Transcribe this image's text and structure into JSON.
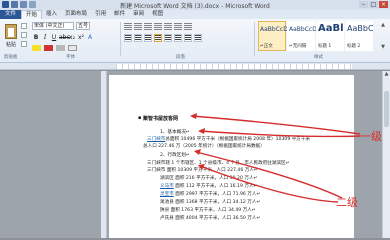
{
  "window": {
    "title": "新建 Microsoft Word 文档 (3).docx - Microsoft Word"
  },
  "tabs": [
    "文件",
    "开始",
    "插入",
    "页面布局",
    "引用",
    "邮件",
    "审阅",
    "视图"
  ],
  "ribbon": {
    "paste_label": "粘贴",
    "font_name": "宋体 (中文正)",
    "font_size": "五号",
    "styles": [
      {
        "sample": "AaBbCcDc",
        "name": "↵正文"
      },
      {
        "sample": "AaBbCcDc",
        "name": "↵无间隔"
      },
      {
        "sample": "AaBl",
        "name": "标题 1"
      },
      {
        "sample": "AaBbC",
        "name": "标题 2"
      }
    ],
    "group_labels": [
      "剪贴板",
      "字体",
      "段落",
      "样式"
    ]
  },
  "document": {
    "heading": "聚智书屋放客网",
    "lines": [
      {
        "text": "1、基本概况↵",
        "link": ""
      },
      {
        "text": "",
        "link": "三门峡市",
        "rest": "总面积 10496 平方千米（根据国家统计局 2008 年）10309 平方千米"
      },
      {
        "text": "总人口 227.46 万（2005 年统计）（根据国家统计局数据）",
        "link": ""
      },
      {
        "text": "2、行政区划↵",
        "link": ""
      },
      {
        "text": "三门峡市辖 1 个市辖区、1 个县级市、4 个县，市人民政府驻湖滨区↵",
        "link": ""
      },
      {
        "text": "三门峡市  面积 10309 平方千米，人口 227.46 万人↵",
        "link": ""
      },
      {
        "text": "湖滨区  面积 216 平方千米，人口 30.20 万人↵",
        "link": ""
      },
      {
        "text": "",
        "link": "义马市",
        "rest": "  面积 112 平方千米，人口 16.19 万人↵"
      },
      {
        "text": "",
        "link": "灵宝市",
        "rest": "  面积 2997 平方千米，人口 71.96 万人↵"
      },
      {
        "text": "渑池县  面积 1368 平方千米，人口 34.12 万人↵",
        "link": ""
      },
      {
        "text": "陕县  面积 1763 平方千米，人口 34.49 万人↵",
        "link": ""
      },
      {
        "text": "卢氏县  面积 4004 平方千米，人口 36.50 万人↵",
        "link": ""
      }
    ]
  },
  "annotations": {
    "level1": "一级",
    "level2": "二级"
  },
  "colors": {
    "annotation_red": "#d62d2d",
    "file_tab": "#2b5797"
  }
}
